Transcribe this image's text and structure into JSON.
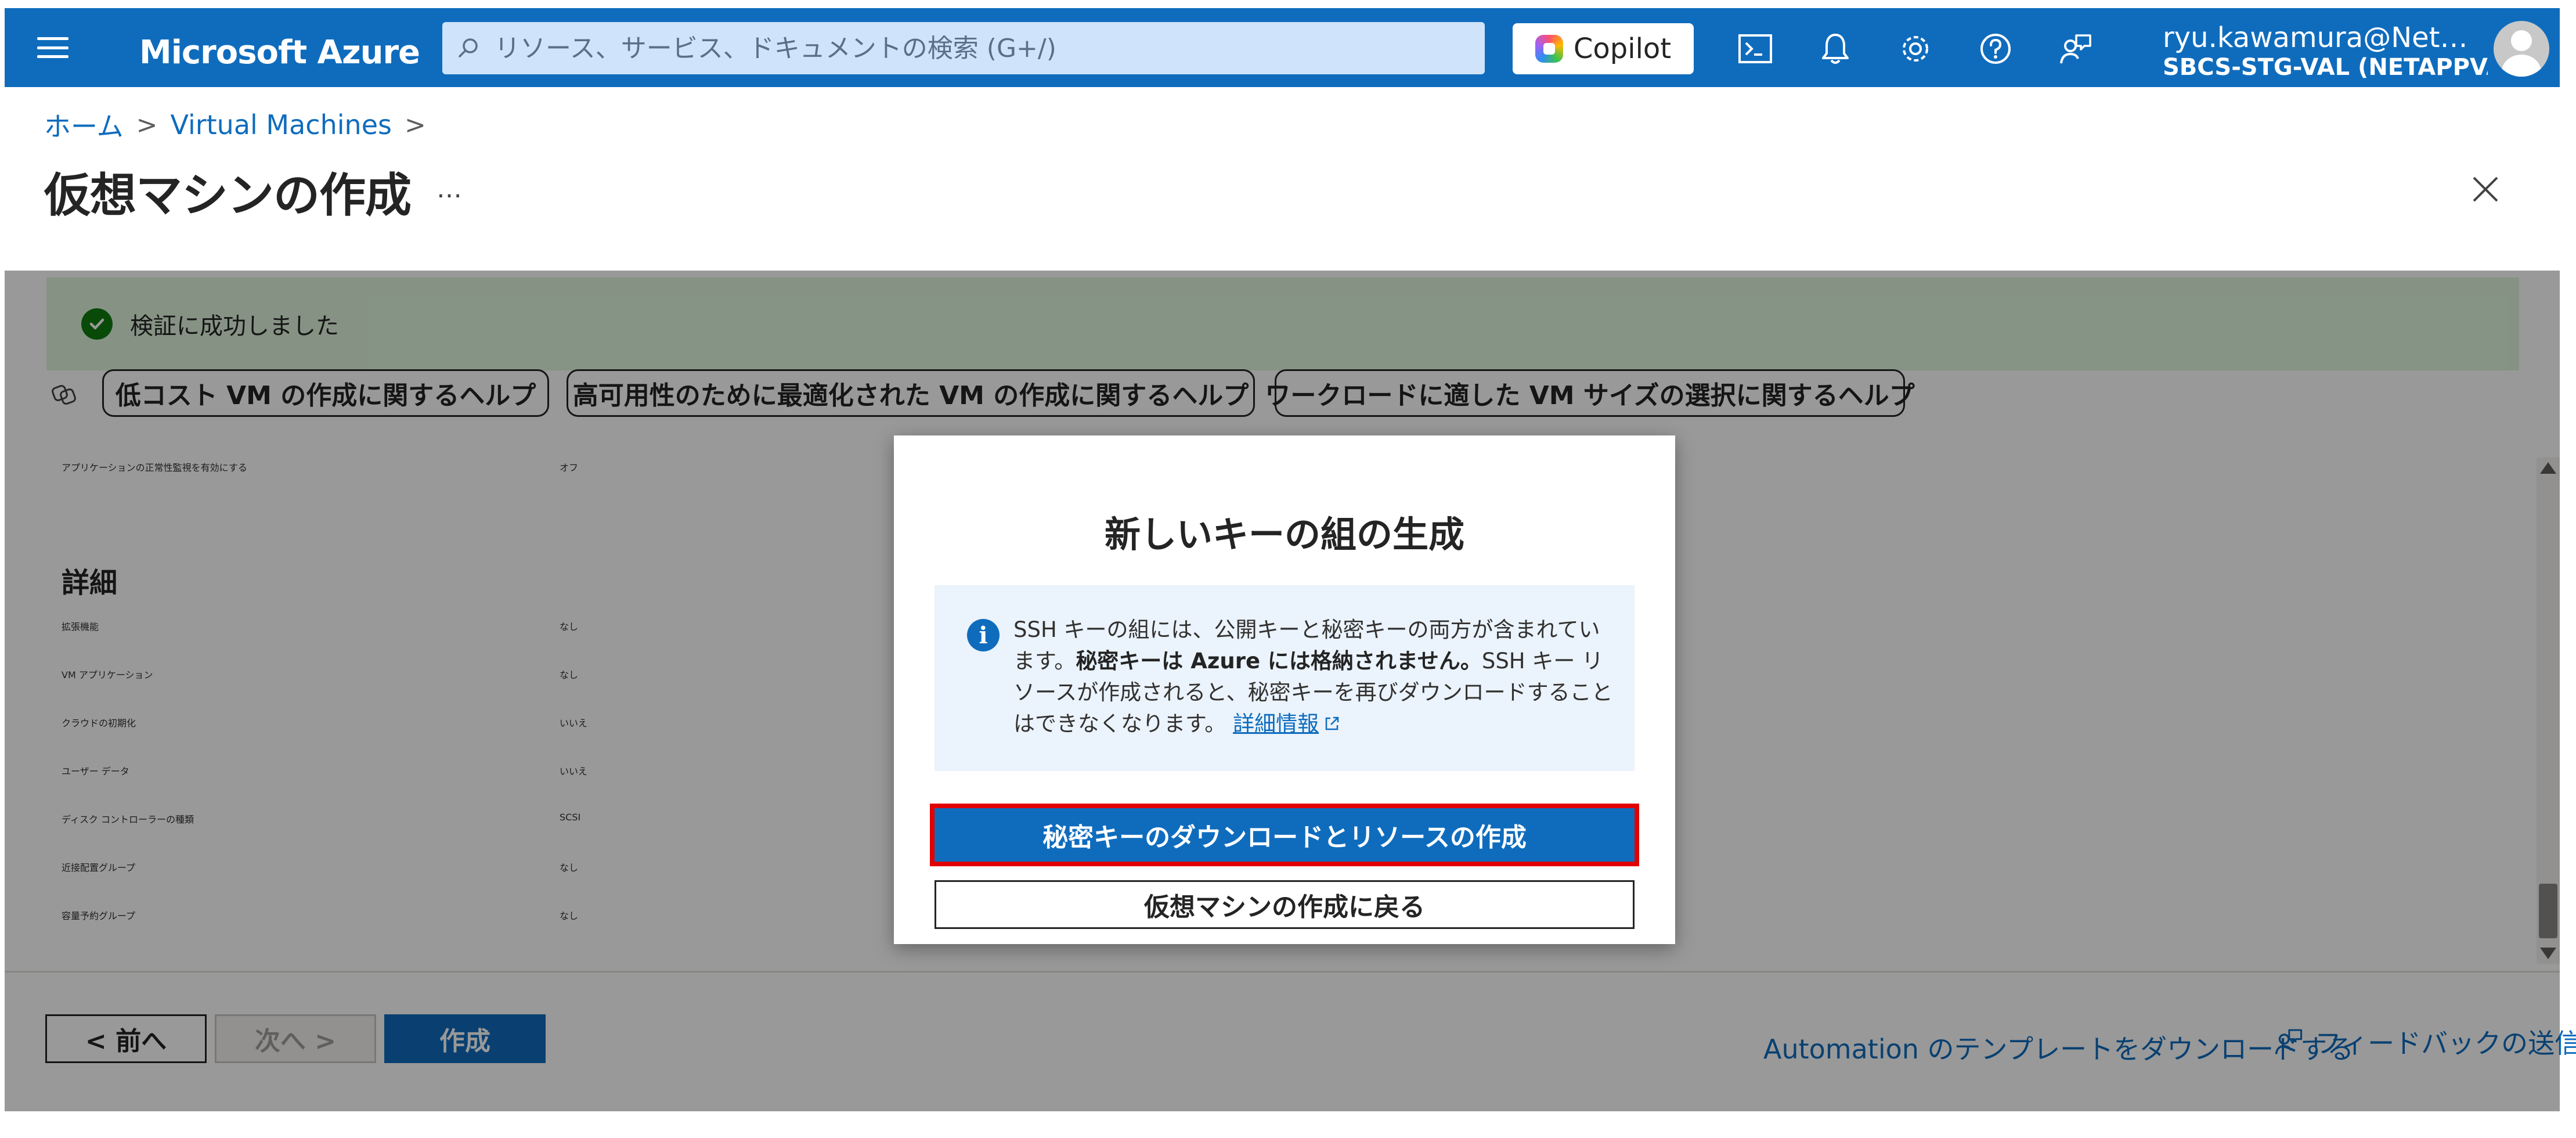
{
  "topbar": {
    "brand": "Microsoft Azure",
    "search_placeholder": "リソース、サービス、ドキュメントの検索 (G+/)",
    "copilot_label": "Copilot",
    "user_email": "ryu.kawamura@Net…",
    "user_tenant": "SBCS-STG-VAL (NETAPPVA…"
  },
  "breadcrumb": {
    "home": "ホーム",
    "vm": "Virtual Machines",
    "sep": ">"
  },
  "page": {
    "title": "仮想マシンの作成",
    "more": "…"
  },
  "validation": {
    "message": "検証に成功しました"
  },
  "help_pills": [
    "低コスト VM の作成に関するヘルプ",
    "高可用性のために最適化された VM の作成に関するヘルプ",
    "ワークロードに適した VM サイズの選択に関するヘルプ"
  ],
  "review": {
    "health_label": "アプリケーションの正常性監視を有効にする",
    "health_value": "オフ",
    "details_header": "詳細",
    "details": [
      {
        "label": "拡張機能",
        "value": "なし"
      },
      {
        "label": "VM アプリケーション",
        "value": "なし"
      },
      {
        "label": "クラウドの初期化",
        "value": "いいえ"
      },
      {
        "label": "ユーザー データ",
        "value": "いいえ"
      },
      {
        "label": "ディスク コントローラーの種類",
        "value": "SCSI"
      },
      {
        "label": "近接配置グループ",
        "value": "なし"
      },
      {
        "label": "容量予約グループ",
        "value": "なし"
      }
    ]
  },
  "footer": {
    "prev": "< 前へ",
    "next": "次へ >",
    "create": "作成",
    "automation_link": "Automation のテンプレートをダウンロードする",
    "feedback": "フィードバックの送信"
  },
  "modal": {
    "title": "新しいキーの組の生成",
    "info_part1": "SSH キーの組には、公開キーと秘密キーの両方が含まれています。",
    "info_bold": "秘密キーは Azure には格納されません。",
    "info_part2": "SSH キー リソースが作成されると、秘密キーを再びダウンロードすることはできなくなります。",
    "info_link": "詳細情報",
    "primary_button": "秘密キーのダウンロードとリソースの作成",
    "secondary_button": "仮想マシンの作成に戻る"
  },
  "colors": {
    "accent": "#0f6cbd",
    "success_bg": "#dff6dd",
    "success_icon": "#107c10",
    "highlight_outline": "#e00000"
  }
}
